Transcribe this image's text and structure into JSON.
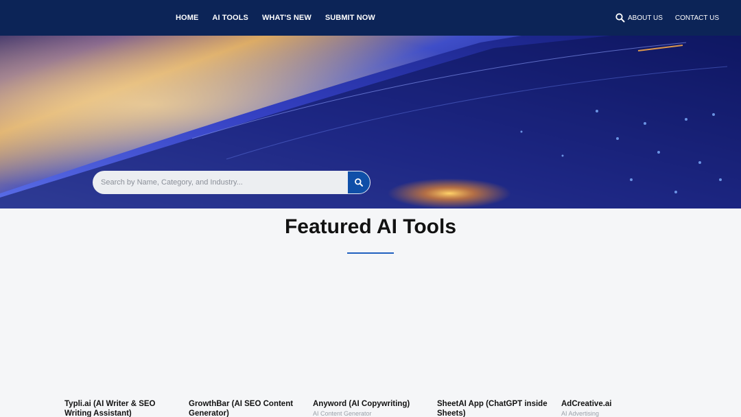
{
  "nav": {
    "main_links": [
      "HOME",
      "AI TOOLS",
      "WHAT'S NEW",
      "SUBMIT NOW"
    ],
    "secondary_links": [
      "ABOUT US",
      "CONTACT US"
    ],
    "search_icon": "search-icon"
  },
  "hero": {
    "search_placeholder": "Search by Name, Category, and Industry...",
    "search_button_icon": "search-icon"
  },
  "featured": {
    "title": "Featured AI Tools",
    "accent_color": "#1f5fbf",
    "tools": [
      {
        "name": "Typli.ai (AI Writer & SEO Writing Assistant)",
        "category": ""
      },
      {
        "name": "GrowthBar (AI SEO Content Generator)",
        "category": ""
      },
      {
        "name": "Anyword (AI Copywriting)",
        "category": "AI Content Generator"
      },
      {
        "name": "SheetAI App (ChatGPT inside Sheets)",
        "category": ""
      },
      {
        "name": "AdCreative.ai",
        "category": "AI Advertising"
      }
    ]
  },
  "colors": {
    "nav_background": "#0c2457",
    "search_button": "#0f4fa8",
    "page_background": "#f5f6f8"
  }
}
